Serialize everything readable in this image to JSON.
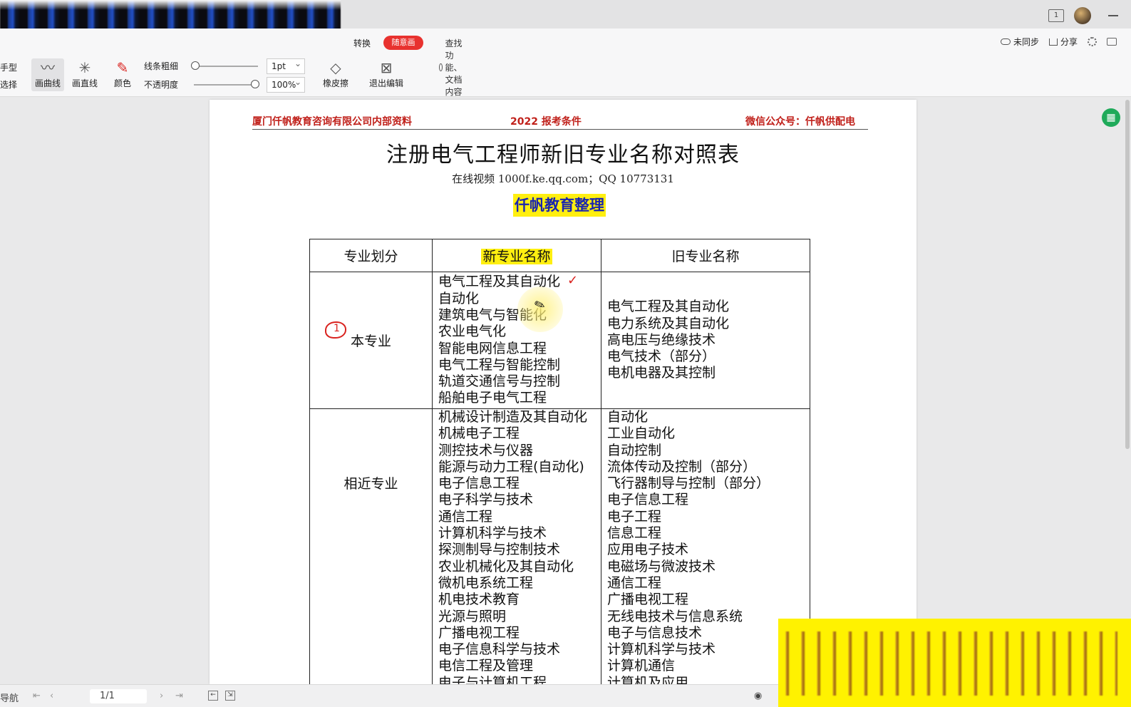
{
  "ribbon": {
    "tabs": [
      "转换"
    ],
    "active_tab": "随意画",
    "search_placeholder": "查找功能、文档内容",
    "right": {
      "sync": "未同步",
      "share": "分享"
    }
  },
  "tools": {
    "left_partial_top": "手型",
    "left_partial_bottom": "选择",
    "curve": "画曲线",
    "line": "画直线",
    "color": "颜色",
    "thickness_label": "线条粗细",
    "thickness_value": "1pt",
    "opacity_label": "不透明度",
    "opacity_value": "100%",
    "eraser": "橡皮擦",
    "exit": "退出编辑"
  },
  "document": {
    "header_left": "厦门仟帆教育咨询有限公司内部资料",
    "header_center": "2022 报考条件",
    "header_right": "微信公众号：仟帆供配电",
    "title": "注册电气工程师新旧专业名称对照表",
    "subtitle": "在线视频 1000f.ke.qq.com；QQ 10773131",
    "org": "仟帆教育整理",
    "table": {
      "headers": [
        "专业划分",
        "新专业名称",
        "旧专业名称"
      ],
      "rows": [
        {
          "category": "本专业",
          "new": [
            "电气工程及其自动化",
            "自动化",
            "建筑电气与智能化",
            "农业电气化",
            "智能电网信息工程",
            "电气工程与智能控制",
            "轨道交通信号与控制",
            "船舶电子电气工程"
          ],
          "old": [
            "电气工程及其自动化",
            "电力系统及其自动化",
            "高电压与绝缘技术",
            "电气技术（部分）",
            "电机电器及其控制"
          ]
        },
        {
          "category": "相近专业",
          "new": [
            "机械设计制造及其自动化",
            "机械电子工程",
            "测控技术与仪器",
            "能源与动力工程(自动化)",
            "电子信息工程",
            "电子科学与技术",
            "通信工程",
            "计算机科学与技术",
            "探测制导与控制技术",
            "农业机械化及其自动化",
            "微机电系统工程",
            "机电技术教育",
            "光源与照明",
            "广播电视工程",
            "电子信息科学与技术",
            "电信工程及管理",
            "电子与计算机工程"
          ],
          "old": [
            "自动化",
            "工业自动化",
            "自动控制",
            "流体传动及控制（部分）",
            "飞行器制导与控制（部分）",
            "电子信息工程",
            "电子工程",
            "信息工程",
            "应用电子技术",
            "电磁场与微波技术",
            "通信工程",
            "广播电视工程",
            "无线电技术与信息系统",
            "电子与信息技术",
            "计算机科学与技术",
            "计算机通信",
            "计算机及应用"
          ]
        }
      ]
    }
  },
  "annotations": {
    "circle_mark": "1"
  },
  "statusbar": {
    "nav_partial": "导航",
    "page": "1/1"
  },
  "colors": {
    "header_red": "#c0201a",
    "highlight_yellow": "#ffef10",
    "org_blue": "#1a25b0",
    "active_tab_red": "#e8322f",
    "annotation_red": "#d9231f"
  }
}
